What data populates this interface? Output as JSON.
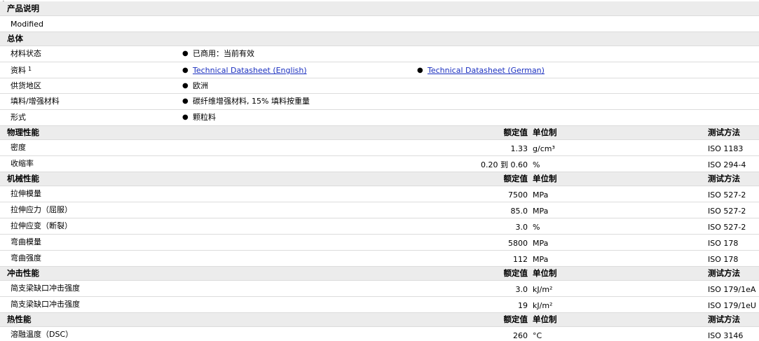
{
  "sections": {
    "product_description": {
      "title": "产品说明",
      "rows": [
        {
          "text": "Modified"
        }
      ]
    },
    "general": {
      "title": "总体",
      "rows": [
        {
          "label": "材料状态",
          "items": [
            "已商用：当前有效"
          ]
        },
        {
          "label": "资料",
          "sup": "1",
          "links": [
            "Technical Datasheet (English)",
            "Technical Datasheet (German)"
          ]
        },
        {
          "label": "供货地区",
          "items": [
            "欧洲"
          ]
        },
        {
          "label": "填料/增强材料",
          "items": [
            "碳纤维增强材料, 15% 填料按重量"
          ]
        },
        {
          "label": "形式",
          "items": [
            "颗粒料"
          ]
        }
      ]
    },
    "col_headers": {
      "rated": "额定值",
      "unit": "单位制",
      "method": "测试方法"
    },
    "physical": {
      "title": "物理性能",
      "rows": [
        {
          "label": "密度",
          "value": "1.33",
          "unit": "g/cm³",
          "method": "ISO 1183"
        },
        {
          "label": "收缩率",
          "value": "0.20 到  0.60",
          "unit": "%",
          "method": "ISO 294-4"
        }
      ]
    },
    "mechanical": {
      "title": "机械性能",
      "rows": [
        {
          "label": "拉伸模量",
          "value": "7500",
          "unit": "MPa",
          "method": "ISO 527-2"
        },
        {
          "label": "拉伸应力（屈服）",
          "value": "85.0",
          "unit": "MPa",
          "method": "ISO 527-2"
        },
        {
          "label": "拉伸应变（断裂）",
          "value": "3.0",
          "unit": "%",
          "method": "ISO 527-2"
        },
        {
          "label": "弯曲模量",
          "value": "5800",
          "unit": "MPa",
          "method": "ISO 178"
        },
        {
          "label": "弯曲强度",
          "value": "112",
          "unit": "MPa",
          "method": "ISO 178"
        }
      ]
    },
    "impact": {
      "title": "冲击性能",
      "rows": [
        {
          "label": "简支梁缺口冲击强度",
          "value": "3.0",
          "unit": "kJ/m²",
          "method": "ISO 179/1eA"
        },
        {
          "label": "简支梁缺口冲击强度",
          "value": "19",
          "unit": "kJ/m²",
          "method": "ISO 179/1eU"
        }
      ]
    },
    "thermal": {
      "title": "热性能",
      "rows": [
        {
          "label": "溶融温度（DSC）",
          "value": "260",
          "unit": "°C",
          "method": "ISO 3146"
        }
      ]
    }
  }
}
